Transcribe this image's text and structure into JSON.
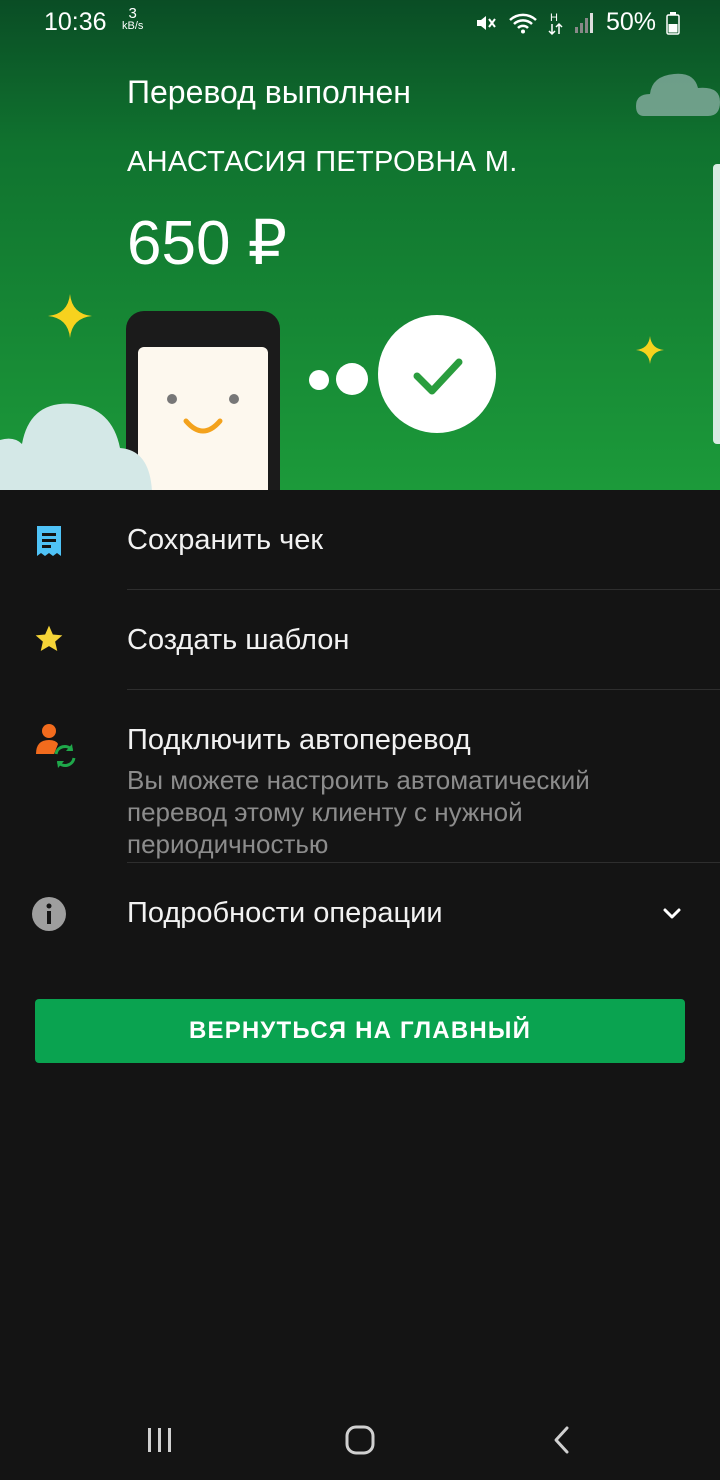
{
  "status_bar": {
    "time": "10:36",
    "speed_value": "3",
    "speed_unit": "kB/s",
    "battery": "50%"
  },
  "hero": {
    "title": "Перевод выполнен",
    "recipient": "АНАСТАСИЯ ПЕТРОВНА М.",
    "amount": "650 ₽"
  },
  "actions": [
    {
      "label": "Сохранить чек",
      "icon": "receipt-icon",
      "icon_color": "#4fc3f7"
    },
    {
      "label": "Создать шаблон",
      "icon": "star-icon",
      "icon_color": "#f5d437"
    },
    {
      "label": "Подключить автоперевод",
      "description": "Вы можете настроить автоматический перевод этому клиенту с нужной периодичностью",
      "icon": "auto-transfer-icon",
      "icon_color": "#f26b1d"
    },
    {
      "label": "Подробности операции",
      "icon": "info-icon",
      "icon_color": "#9e9e9e"
    }
  ],
  "main_button": {
    "label": "ВЕРНУТЬСЯ НА ГЛАВНЫЙ"
  },
  "colors": {
    "accent": "#0aa350",
    "background": "#141414"
  }
}
